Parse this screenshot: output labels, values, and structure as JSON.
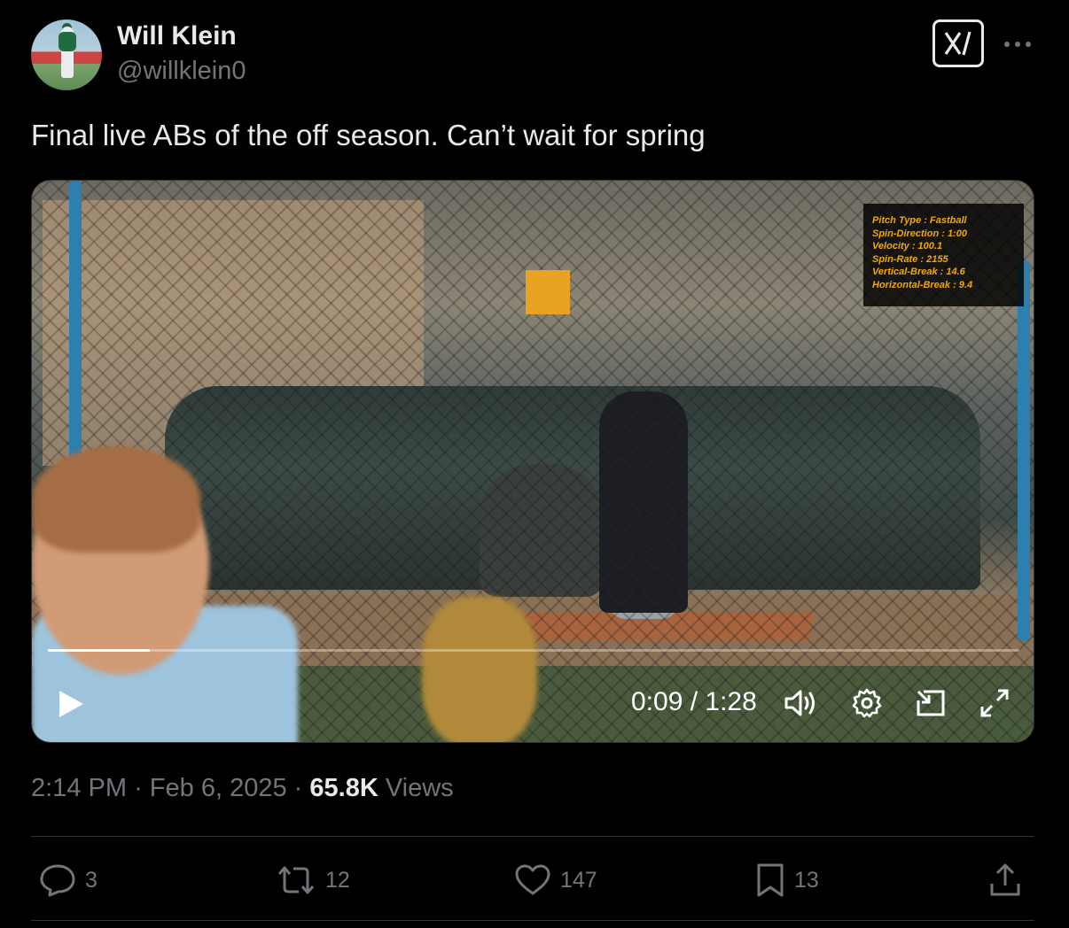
{
  "author": {
    "display_name": "Will Klein",
    "handle": "@willklein0"
  },
  "tweet": {
    "text": "Final live ABs of the off season. Can’t wait for spring"
  },
  "video": {
    "pitch_overlay": [
      "Pitch Type : Fastball",
      "Spin-Direction : 1:00",
      "Velocity : 100.1",
      "Spin-Rate : 2155",
      "Vertical-Break : 14.6",
      "Horizontal-Break : 9.4"
    ],
    "time": "0:09 / 1:28",
    "progress_fraction": 0.105,
    "icons": {
      "play": "play-icon",
      "volume": "volume-icon",
      "settings": "gear-icon",
      "pip": "picture-in-picture-icon",
      "fullscreen": "fullscreen-icon"
    }
  },
  "meta": {
    "time": "2:14 PM",
    "date": "Feb 6, 2025",
    "separator": "·",
    "views_count": "65.8K",
    "views_label": "Views"
  },
  "actions": {
    "replies": "3",
    "reposts": "12",
    "likes": "147",
    "bookmarks": "13"
  }
}
